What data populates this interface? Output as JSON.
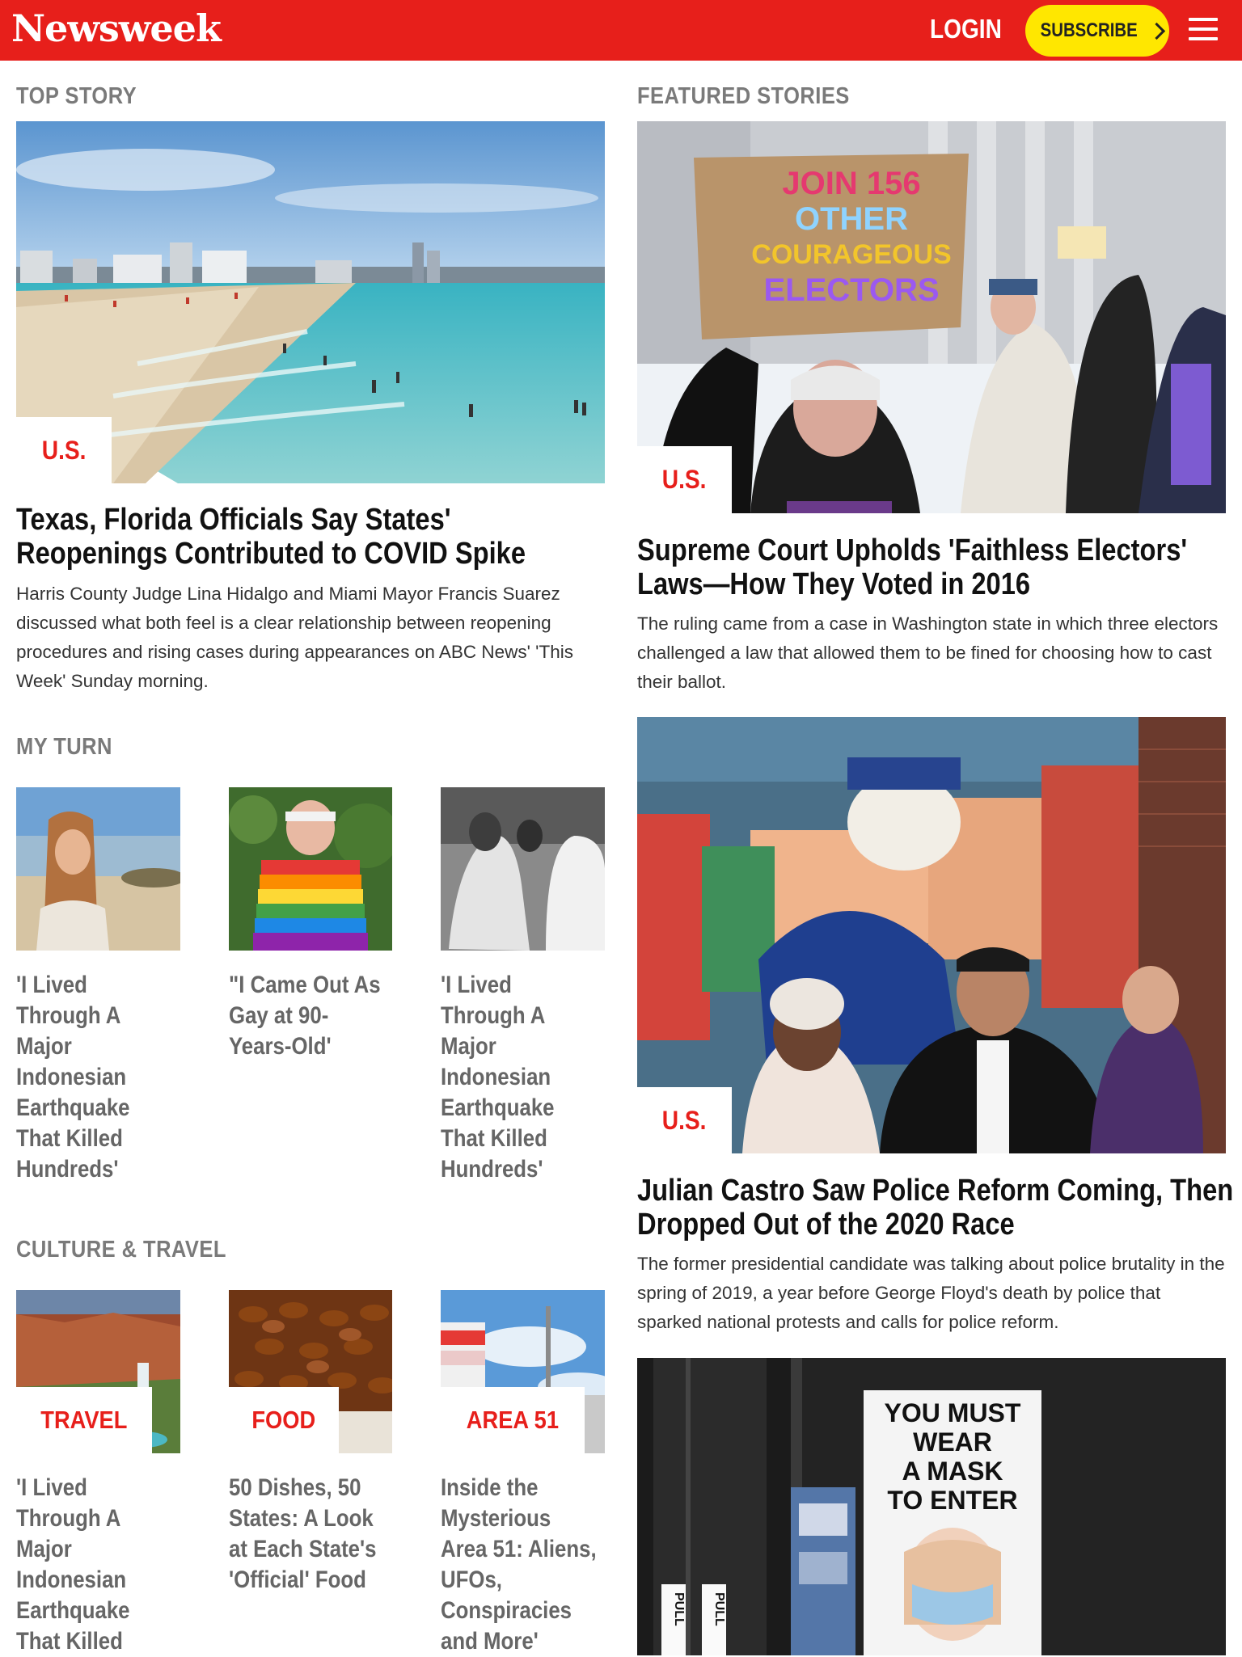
{
  "header": {
    "logo": "Newsweek",
    "login_label": "LOGIN",
    "subscribe_label": "SUBSCRIBE",
    "brand_color": "#e71f1b",
    "subscribe_color": "#ffe700"
  },
  "top_story": {
    "section_label": "TOP STORY",
    "tag": "U.S.",
    "headline": "Texas, Florida Officials Say States' Reopenings Contributed to COVID Spike",
    "summary": "Harris County Judge Lina Hidalgo and Miami Mayor Francis Suarez discussed what both feel is a clear relationship between reopening procedures and rising cases during appearances on ABC News' 'This Week' Sunday morning."
  },
  "my_turn": {
    "section_label": "MY TURN",
    "items": [
      {
        "title": "'I Lived Through A Major Indonesian Earthquake That Killed Hundreds'"
      },
      {
        "title": "\"I Came Out As Gay at 90-Years-Old'"
      },
      {
        "title": "'I Lived Through A Major Indonesian Earthquake That Killed Hundreds'"
      }
    ]
  },
  "culture_travel": {
    "section_label": "CULTURE & TRAVEL",
    "items": [
      {
        "tag": "TRAVEL",
        "title": "'I Lived Through A Major Indonesian Earthquake That Killed"
      },
      {
        "tag": "FOOD",
        "title": "50 Dishes, 50 States: A Look at Each State's 'Official' Food"
      },
      {
        "tag": "AREA 51",
        "title": "Inside the Mysterious Area 51: Aliens, UFOs, Conspiracies and More'"
      }
    ]
  },
  "featured": {
    "section_label": "FEATURED STORIES",
    "stories": [
      {
        "tag": "U.S.",
        "headline": "Supreme Court Upholds 'Faithless Electors' Laws—How They Voted in 2016",
        "summary": "The ruling came from a case in Washington state in which three electors challenged a law that allowed them to be fined for choosing how to cast their ballot.",
        "sign_lines": [
          "JOIN 156",
          "OTHER",
          "COURAGEOUS",
          "ELECTORS"
        ]
      },
      {
        "tag": "U.S.",
        "headline": "Julian Castro Saw Police Reform Coming, Then Dropped Out of the 2020 Race",
        "summary": "The former presidential candidate was talking about police brutality in the spring of 2019, a year before George Floyd's death by police that sparked national protests and calls for police reform."
      },
      {
        "sign_lines": [
          "YOU MUST",
          "WEAR",
          "A MASK",
          "TO ENTER"
        ],
        "door_label": "PULL"
      }
    ]
  }
}
